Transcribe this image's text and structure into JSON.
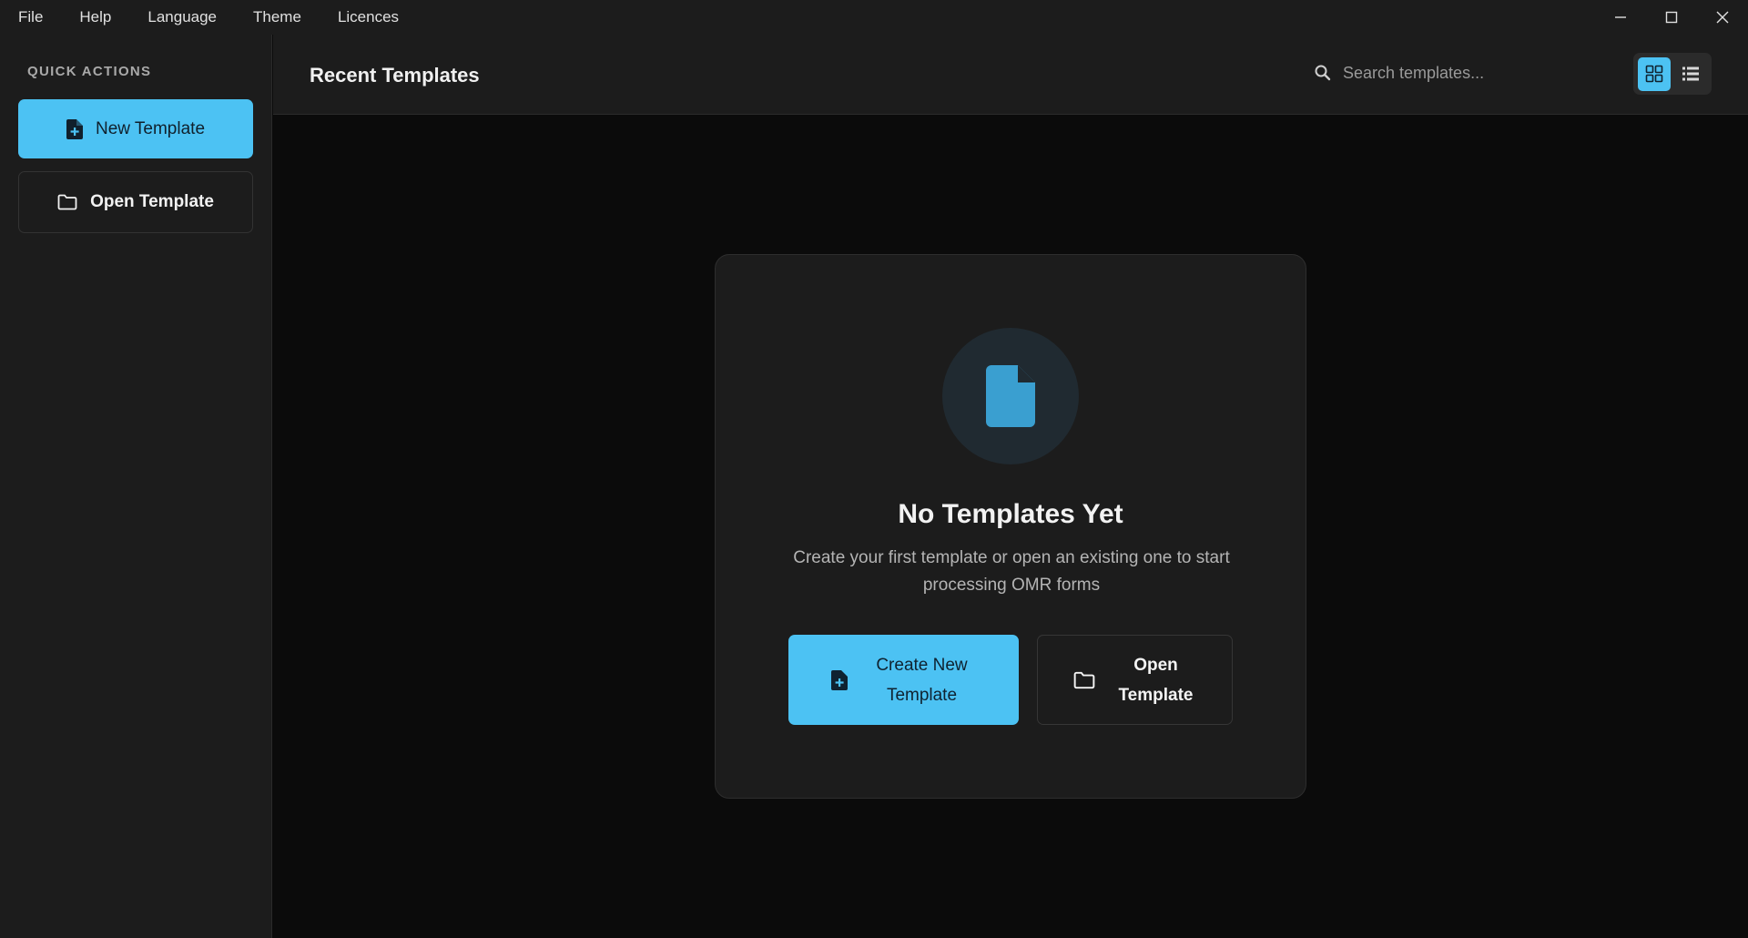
{
  "menubar": {
    "items": [
      "File",
      "Help",
      "Language",
      "Theme",
      "Licences"
    ]
  },
  "window_controls": {
    "icons": [
      "minimize-icon",
      "maximize-icon",
      "close-icon"
    ]
  },
  "sidebar": {
    "title": "QUICK ACTIONS",
    "new_template_label": "New Template",
    "open_template_label": "Open Template",
    "icons": [
      "file-plus-icon",
      "folder-icon"
    ]
  },
  "header": {
    "title": "Recent Templates",
    "search_placeholder": "Search templates...",
    "view_modes": [
      "grid",
      "list"
    ],
    "active_view": "grid"
  },
  "empty_state": {
    "title": "No Templates Yet",
    "description": "Create your first template or open an existing one to start processing OMR forms",
    "create_label": "Create New Template",
    "open_label": "Open Template",
    "icon": "document-icon"
  },
  "colors": {
    "accent": "#4cc2f3",
    "background": "#0b0b0b",
    "panel": "#1c1c1c"
  }
}
